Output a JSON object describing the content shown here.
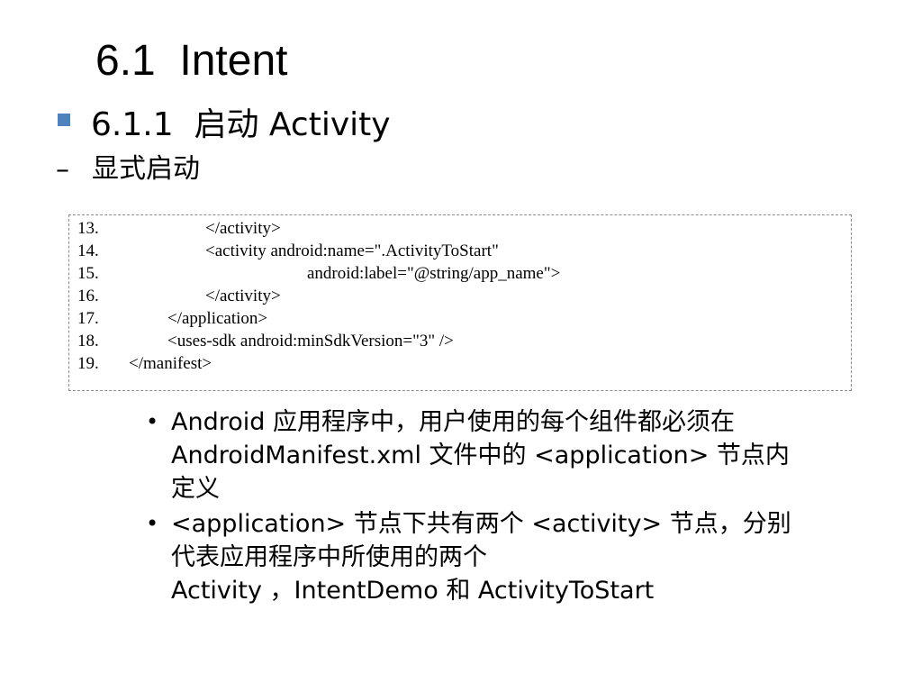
{
  "slide": {
    "title": "6.1  Intent",
    "heading": {
      "text": "6.1.1  启动 Activity",
      "bullet_color": "#4F81BD"
    },
    "subheading": {
      "bullet": "–",
      "text": "显式启动"
    },
    "code": {
      "lines": [
        {
          "num": "13.",
          "text": "</activity>"
        },
        {
          "num": "14.",
          "text": "<activity android:name=\".ActivityToStart\""
        },
        {
          "num": "15.",
          "text": "android:label=\"@string/app_name\">"
        },
        {
          "num": "16.",
          "text": "</activity>"
        },
        {
          "num": "17.",
          "text": "</application>"
        },
        {
          "num": "18.",
          "text": "<uses-sdk android:minSdkVersion=\"3\" />"
        },
        {
          "num": "19.",
          "text": "</manifest>"
        }
      ]
    },
    "bullets": [
      {
        "lines": [
          "Android 应用程序中，用户使用的每个组件都必须在",
          "AndroidManifest.xml 文件中的 <application> 节点内",
          "定义"
        ]
      },
      {
        "lines": [
          "<application> 节点下共有两个 <activity> 节点，分别",
          "代表应用程序中所使用的两个",
          "Activity  ，IntentDemo 和 ActivityToStart"
        ]
      }
    ]
  }
}
